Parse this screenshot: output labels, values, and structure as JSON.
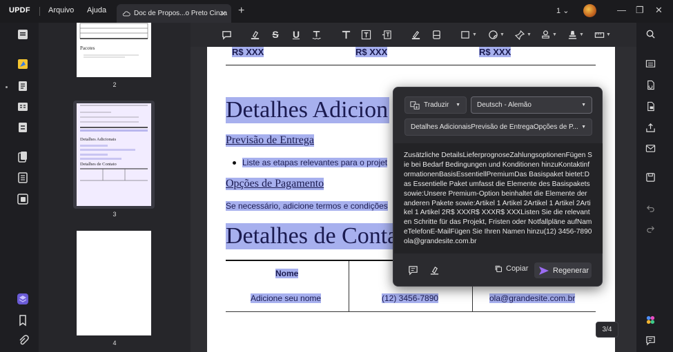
{
  "app": {
    "logo": "UPDF",
    "menu": [
      "Arquivo",
      "Ajuda"
    ],
    "tab_title": "Doc de Propos...o Preto Cinza",
    "page_selector": "1",
    "colors": {
      "accent": "#7b5cf0",
      "highlight": "#a7b0ee",
      "text_blue": "#1b1b50"
    }
  },
  "thumbnails": {
    "pages": [
      {
        "label": "2",
        "title": "Pacotes"
      },
      {
        "label": "3",
        "title": "Detalhes Adicionais",
        "subtitle": "Detalhes de Contato"
      },
      {
        "label": "4"
      }
    ]
  },
  "document": {
    "price_row": [
      "R$ XXX",
      "R$ XXX",
      "R$ XXX"
    ],
    "heading1": "Detalhes Adicion",
    "link1": "Previsão de Entrega",
    "bullet": "Liste as etapas relevantes para o projet",
    "link2": "Opções de Pagamento",
    "para": "Se necessário, adicione termos e condições",
    "heading2": "Detalhes de Conta",
    "table": {
      "header": "Nome",
      "row": [
        "Adicione seu nome",
        "(12) 3456-7890",
        "ola@grandesite.com.br"
      ]
    }
  },
  "translate_popup": {
    "mode": "Traduzir",
    "language": "Deutsch - Alemão",
    "source": "Detalhes AdicionaisPrevisão de EntregaOpções de P...",
    "result": "Zusätzliche DetailsLieferprognoseZahlungsoptionenFügen Sie bei Bedarf Bedingungen und Konditionen hinzuKontaktinformationenBasisEssentiellPremiumDas Basispaket bietet:Das Essentielle Paket umfasst die Elemente des Basispakets sowie:Unsere Premium-Option beinhaltet die Elemente der anderen Pakete sowie:Artikel 1 Artikel 2Artikel 1 Artikel 2Artikel 1 Artikel 2R$ XXXR$ XXXR$ XXXListen Sie die relevanten Schritte für das Projekt, Fristen oder Notfallpläne aufNameTelefonE-MailFügen Sie Ihren Namen hinzu(12) 3456-7890ola@grandesite.com.br",
    "copy_label": "Copiar",
    "regen_label": "Regenerar"
  },
  "page_indicator": "3/4"
}
